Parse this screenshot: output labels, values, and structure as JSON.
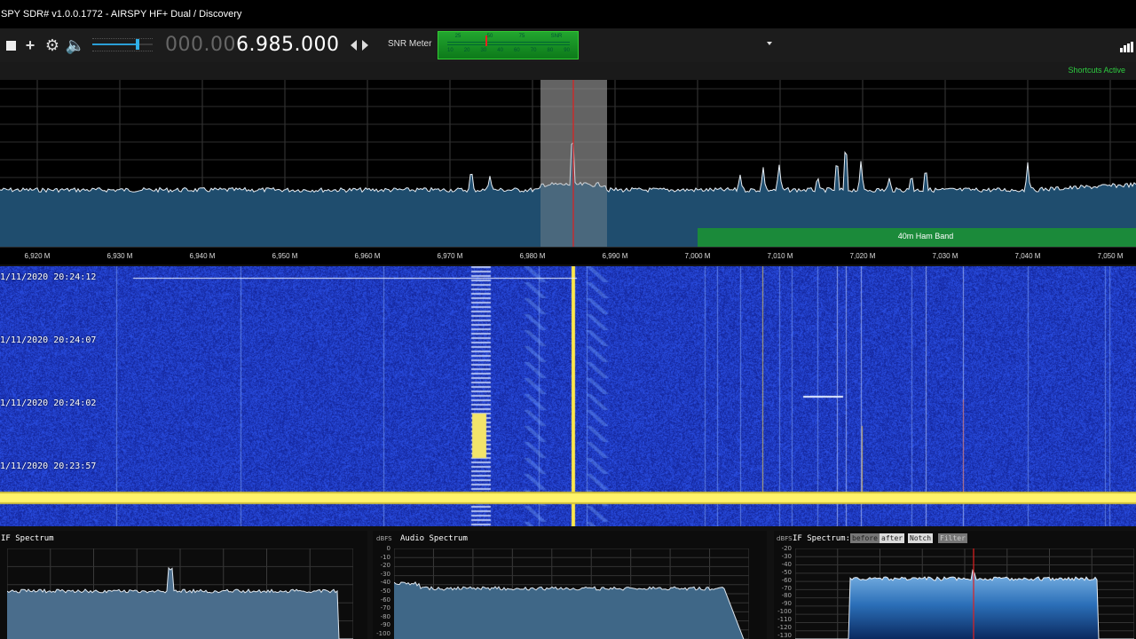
{
  "window": {
    "title": "SPY SDR# v1.0.0.1772 - AIRSPY HF+ Dual / Discovery"
  },
  "toolbar": {
    "freq_prefix": "000.00",
    "freq_main": "6.985.000",
    "snr_label": "SNR Meter",
    "snr_scale_top": [
      "25",
      "50",
      "75",
      "SNR"
    ],
    "snr_scale_bottom": [
      "10",
      "20",
      "30",
      "40",
      "60",
      "70",
      "80",
      "90"
    ],
    "volume_level": 0.75
  },
  "status": {
    "shortcuts": "Shortcuts Active"
  },
  "spectrum": {
    "freq_ticks": [
      "6,920 M",
      "6,930 M",
      "6,940 M",
      "6,950 M",
      "6,960 M",
      "6,970 M",
      "6,980 M",
      "6,990 M",
      "7,000 M",
      "7,010 M",
      "7,020 M",
      "7,030 M",
      "7,040 M",
      "7,050 M"
    ],
    "band_label": "40m Ham Band",
    "accent": "#1b8a3a"
  },
  "waterfall": {
    "timestamps": [
      "1/11/2020 20:24:12",
      "1/11/2020 20:24:07",
      "1/11/2020 20:24:02",
      "1/11/2020 20:23:57"
    ]
  },
  "if_spectrum": {
    "title": "IF Spectrum"
  },
  "audio_spectrum": {
    "unit": "dBFS",
    "title": "Audio Spectrum",
    "scale": [
      "0",
      "-10",
      "-20",
      "-30",
      "-40",
      "-50",
      "-60",
      "-70",
      "-80",
      "-90",
      "-100"
    ]
  },
  "if_spectrum2": {
    "unit": "dBFS",
    "title": "IF Spectrum:",
    "tags": [
      "before",
      "after",
      "Notch",
      "Filter"
    ],
    "scale": [
      "-20",
      "-30",
      "-40",
      "-50",
      "-60",
      "-70",
      "-80",
      "-90",
      "-100",
      "-110",
      "-120",
      "-130"
    ]
  }
}
